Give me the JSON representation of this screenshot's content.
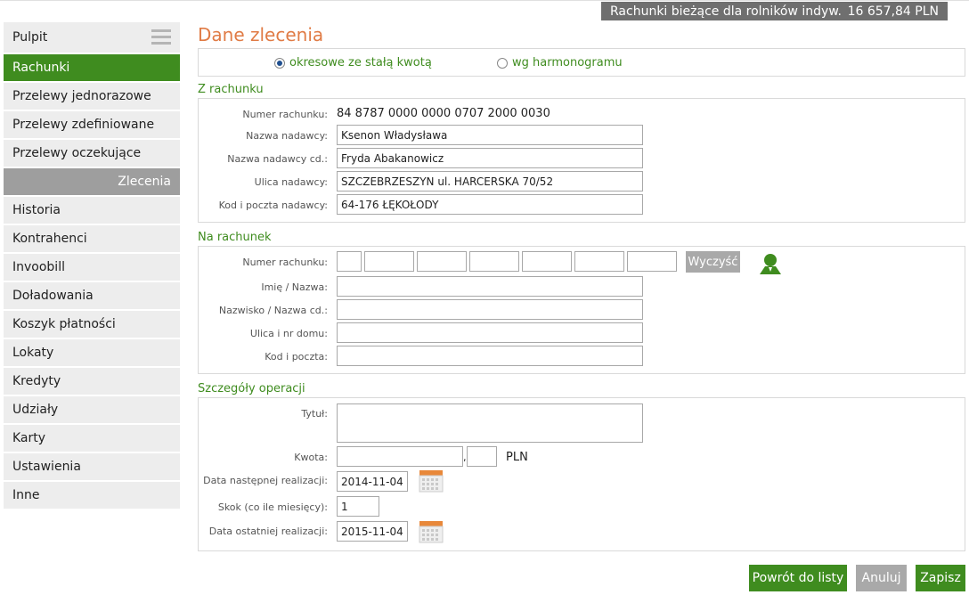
{
  "account_bar": {
    "name": "Rachunki bieżące dla rolników indyw.",
    "balance": "16 657,84 PLN"
  },
  "sidebar": {
    "items": [
      {
        "label": "Pulpit"
      },
      {
        "label": "Rachunki"
      },
      {
        "label": "Przelewy jednorazowe"
      },
      {
        "label": "Przelewy zdefiniowane"
      },
      {
        "label": "Przelewy oczekujące"
      },
      {
        "label": "Zlecenia"
      },
      {
        "label": "Historia"
      },
      {
        "label": "Kontrahenci"
      },
      {
        "label": "Invoobill"
      },
      {
        "label": "Doładowania"
      },
      {
        "label": "Koszyk płatności"
      },
      {
        "label": "Lokaty"
      },
      {
        "label": "Kredyty"
      },
      {
        "label": "Udziały"
      },
      {
        "label": "Karty"
      },
      {
        "label": "Ustawienia"
      },
      {
        "label": "Inne"
      }
    ]
  },
  "page": {
    "title": "Dane zlecenia",
    "radio_fixed": "okresowe ze stałą kwotą",
    "radio_schedule": "wg harmonogramu"
  },
  "from_account": {
    "header": "Z rachunku",
    "number_label": "Numer rachunku:",
    "number_value": "84 8787 0000 0000 0707 2000 0030",
    "sender_label": "Nazwa nadawcy:",
    "sender_value": "Ksenon Władysława",
    "sender2_label": "Nazwa nadawcy cd.:",
    "sender2_value": "Fryda Abakanowicz",
    "street_label": "Ulica nadawcy:",
    "street_value": "SZCZEBRZESZYN ul. HARCERSKA 70/52",
    "postal_label": "Kod i poczta nadawcy:",
    "postal_value": "64-176 ŁĘKOŁODY"
  },
  "to_account": {
    "header": "Na rachunek",
    "number_label": "Numer rachunku:",
    "clear_button": "Wyczyść",
    "name_label": "Imię / Nazwa:",
    "name2_label": "Nazwisko / Nazwa cd.:",
    "street_label": "Ulica i nr domu:",
    "postal_label": "Kod i poczta:"
  },
  "details": {
    "header": "Szczegóły operacji",
    "title_label": "Tytuł:",
    "amount_label": "Kwota:",
    "amount_separator": ",",
    "currency": "PLN",
    "next_date_label": "Data następnej realizacji:",
    "next_date_value": "2014-11-04",
    "step_label": "Skok (co ile miesięcy):",
    "step_value": "1",
    "last_date_label": "Data ostatniej realizacji:",
    "last_date_value": "2015-11-04"
  },
  "buttons": {
    "back": "Powrót do listy",
    "cancel": "Anuluj",
    "save": "Zapisz"
  },
  "colors": {
    "accent_green": "#3f8c1f",
    "title_orange": "#e07b45",
    "bar_grey": "#6f6f6f"
  }
}
